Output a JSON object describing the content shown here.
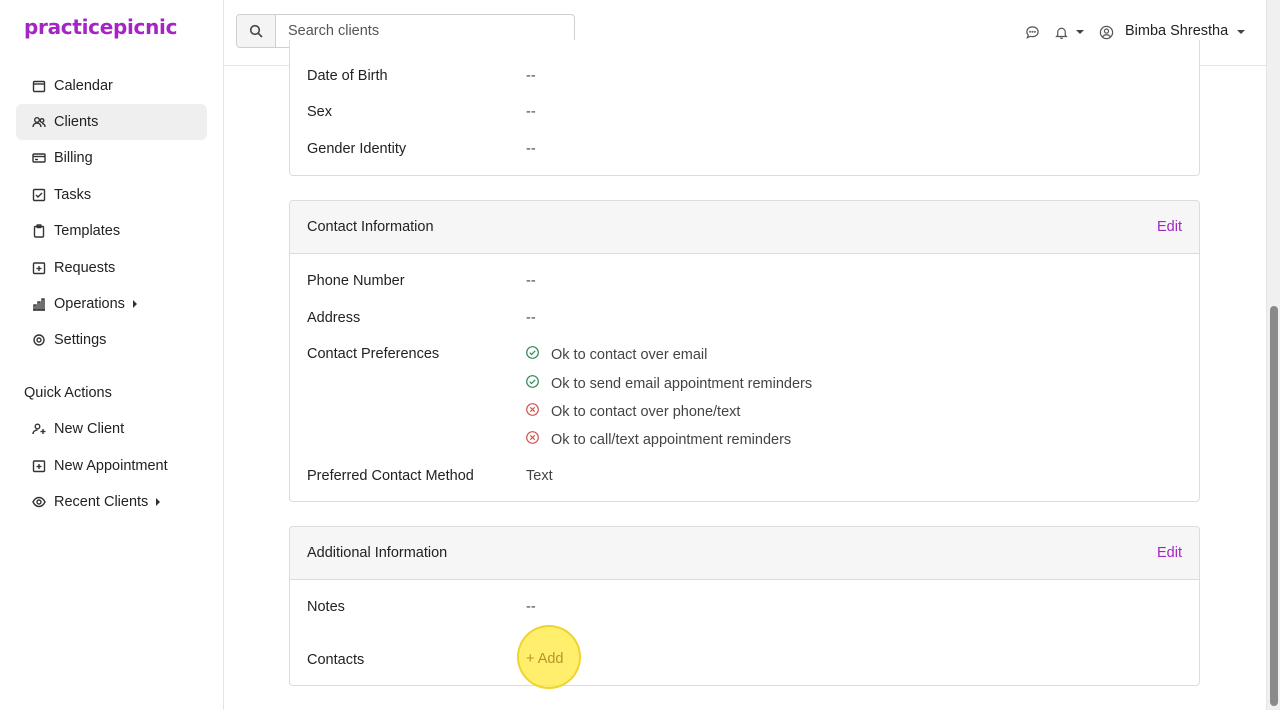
{
  "app": {
    "logo": "practicepicnic"
  },
  "sidebar": {
    "items": [
      {
        "label": "Calendar"
      },
      {
        "label": "Clients"
      },
      {
        "label": "Billing"
      },
      {
        "label": "Tasks"
      },
      {
        "label": "Templates"
      },
      {
        "label": "Requests"
      },
      {
        "label": "Operations"
      },
      {
        "label": "Settings"
      }
    ],
    "quick_actions_title": "Quick Actions",
    "quick_actions": [
      {
        "label": "New Client"
      },
      {
        "label": "New Appointment"
      },
      {
        "label": "Recent Clients"
      }
    ]
  },
  "header": {
    "search_placeholder": "Search clients",
    "user_name": "Bimba Shrestha"
  },
  "personal": {
    "rows": [
      {
        "label": "Date of Birth",
        "value": "--"
      },
      {
        "label": "Sex",
        "value": "--"
      },
      {
        "label": "Gender Identity",
        "value": "--"
      }
    ]
  },
  "contact": {
    "title": "Contact Information",
    "edit_label": "Edit",
    "phone_label": "Phone Number",
    "phone_value": "--",
    "address_label": "Address",
    "address_value": "--",
    "prefs_label": "Contact Preferences",
    "prefs": [
      {
        "text": "Ok to contact over email",
        "status": "ok"
      },
      {
        "text": "Ok to send email appointment reminders",
        "status": "ok"
      },
      {
        "text": "Ok to contact over phone/text",
        "status": "no"
      },
      {
        "text": "Ok to call/text appointment reminders",
        "status": "no"
      }
    ],
    "method_label": "Preferred Contact Method",
    "method_value": "Text"
  },
  "additional": {
    "title": "Additional Information",
    "edit_label": "Edit",
    "notes_label": "Notes",
    "notes_value": "--",
    "contacts_label": "Contacts",
    "add_label": "+ Add"
  },
  "colors": {
    "brand": "#a424c6",
    "ok": "#2f8a52",
    "no": "#d9534f"
  }
}
